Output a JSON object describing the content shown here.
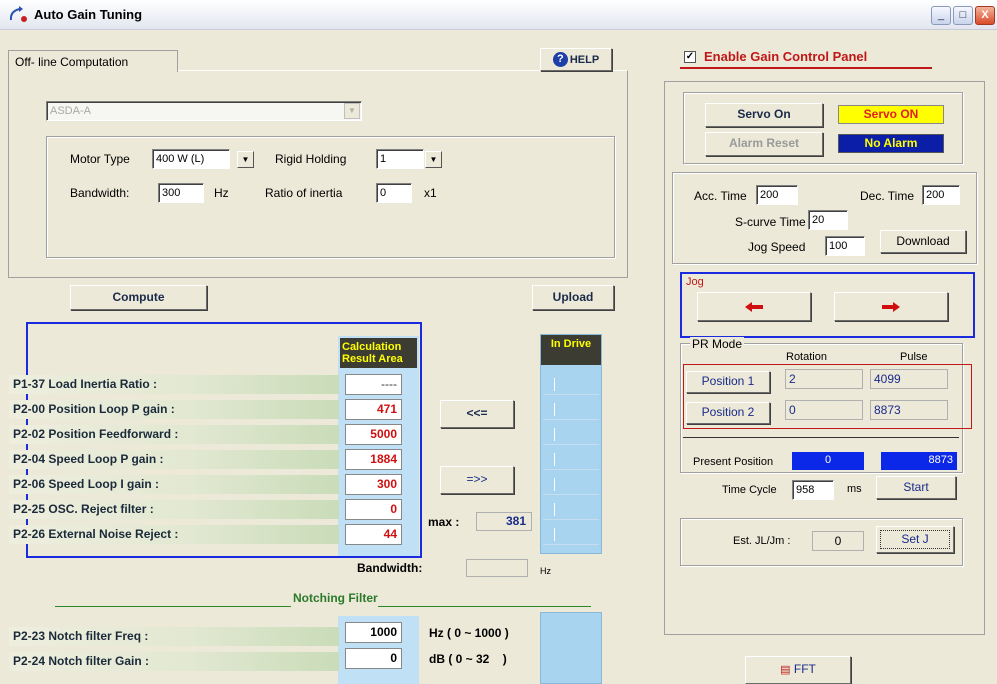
{
  "window": {
    "title": "Auto Gain Tuning",
    "min_label": "_",
    "max_label": "□",
    "close_label": "X"
  },
  "left": {
    "tab_label": "Off- line Computation",
    "help_label": "HELP",
    "model_select": "ASDA-A",
    "motor_type_label": "Motor Type",
    "motor_type_value": "400 W (L)",
    "rigid_holding_label": "Rigid Holding",
    "rigid_holding_value": "1",
    "bandwidth_label": "Bandwidth:",
    "bandwidth_value": "300",
    "bandwidth_unit": "Hz",
    "ratio_label": "Ratio of inertia",
    "ratio_value": "0",
    "ratio_unit": "x1",
    "compute_label": "Compute",
    "upload_label": "Upload"
  },
  "results": {
    "calc_header_1": "Calculation",
    "calc_header_2": "Result Area",
    "drive_header": "In Drive",
    "rows": [
      {
        "label": "P1-37 Load Inertia Ratio :",
        "value": "----"
      },
      {
        "label": "P2-00 Position Loop P gain :",
        "value": "471"
      },
      {
        "label": "P2-02 Position Feedforward :",
        "value": "5000"
      },
      {
        "label": "P2-04 Speed Loop P gain :",
        "value": "1884"
      },
      {
        "label": "P2-06 Speed Loop I gain :",
        "value": "300"
      },
      {
        "label": "P2-25 OSC. Reject filter :",
        "value": "0"
      },
      {
        "label": "P2-26 External Noise Reject :",
        "value": "44"
      }
    ],
    "to_calc_label": "<<=",
    "to_drive_label": "=>>",
    "max_label": "max :",
    "max_value": "381",
    "bandwidth_label": "Bandwidth:",
    "bandwidth_unit": "Hz"
  },
  "notch": {
    "title": "Notching Filter",
    "freq_label": "P2-23 Notch filter Freq :",
    "freq_value": "1000",
    "freq_range": "Hz ( 0 ~ 1000 )",
    "gain_label": "P2-24 Notch filter Gain :",
    "gain_value": "0",
    "gain_range": "dB ( 0 ~ 32    )"
  },
  "right": {
    "enable_label": "Enable Gain Control Panel",
    "servo_on_button": "Servo On",
    "servo_status": "Servo ON",
    "alarm_reset_button": "Alarm Reset",
    "alarm_status": "No Alarm",
    "acc_label": "Acc. Time",
    "acc_value": "200",
    "dec_label": "Dec. Time",
    "dec_value": "200",
    "scurve_label": "S-curve Time",
    "scurve_value": "20",
    "jog_speed_label": "Jog Speed",
    "jog_speed_value": "100",
    "download_label": "Download",
    "jog_title": "Jog",
    "pr_title": "PR Mode",
    "rotation_header": "Rotation",
    "pulse_header": "Pulse",
    "pos1_label": "Position 1",
    "pos1_rotation": "2",
    "pos1_pulse": "4099",
    "pos2_label": "Position 2",
    "pos2_rotation": "0",
    "pos2_pulse": "8873",
    "present_label": "Present Position",
    "present_rotation": "0",
    "present_pulse": "8873",
    "cycle_label": "Time Cycle",
    "cycle_value": "958",
    "cycle_unit": "ms",
    "start_label": "Start",
    "est_label": "Est. JL/Jm :",
    "est_value": "0",
    "setj_label": "Set J",
    "fft_label": "FFT"
  },
  "colors": {
    "accent_blue": "#0b28e8",
    "warn_yellow": "#ffff00",
    "result_red": "#d01010",
    "group_blue": "#1a2adf"
  }
}
